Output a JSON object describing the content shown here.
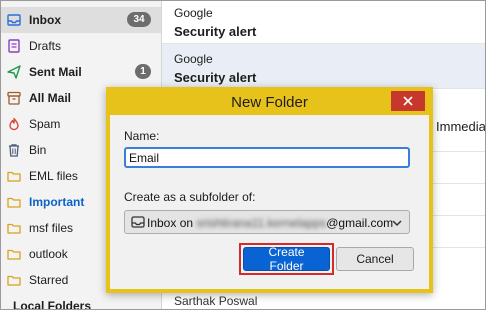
{
  "sidebar": {
    "items": [
      {
        "label": "Inbox",
        "icon": "inbox-icon",
        "badge": "34",
        "bold": true,
        "selected": true
      },
      {
        "label": "Drafts",
        "icon": "drafts-icon"
      },
      {
        "label": "Sent Mail",
        "icon": "sent-icon",
        "badge": "1",
        "bold": true
      },
      {
        "label": "All Mail",
        "icon": "archive-icon",
        "bold": true
      },
      {
        "label": "Spam",
        "icon": "spam-icon"
      },
      {
        "label": "Bin",
        "icon": "trash-icon"
      },
      {
        "label": "EML files",
        "icon": "folder-icon"
      },
      {
        "label": "Important",
        "icon": "folder-icon",
        "highlight": true
      },
      {
        "label": "msf files",
        "icon": "folder-icon"
      },
      {
        "label": "outlook",
        "icon": "folder-icon"
      },
      {
        "label": "Starred",
        "icon": "folder-icon"
      },
      {
        "label": "Local Folders",
        "icon": "none",
        "bold": true
      }
    ]
  },
  "message_list": {
    "messages": [
      {
        "sender": "Google",
        "subject": "Security alert"
      },
      {
        "sender": "Google",
        "subject": "Security alert"
      }
    ],
    "peek_text_right": "Immedia",
    "peek_text_bottom": "Sarthak Poswal"
  },
  "dialog": {
    "title": "New Folder",
    "name_label": "Name:",
    "name_value": "Email",
    "subfolder_label": "Create as a subfolder of:",
    "parent_prefix": "Inbox on",
    "parent_account_local": "srishtirana11.kernelapps",
    "parent_account_domain": "@gmail.com",
    "create_button": "Create Folder",
    "cancel_button": "Cancel"
  },
  "colors": {
    "dialog_accent": "#e6c21b",
    "close_button": "#c6382b",
    "primary_button": "#0a63d3",
    "highlight_outline": "#d42a2a",
    "important_label": "#0b63c9"
  }
}
